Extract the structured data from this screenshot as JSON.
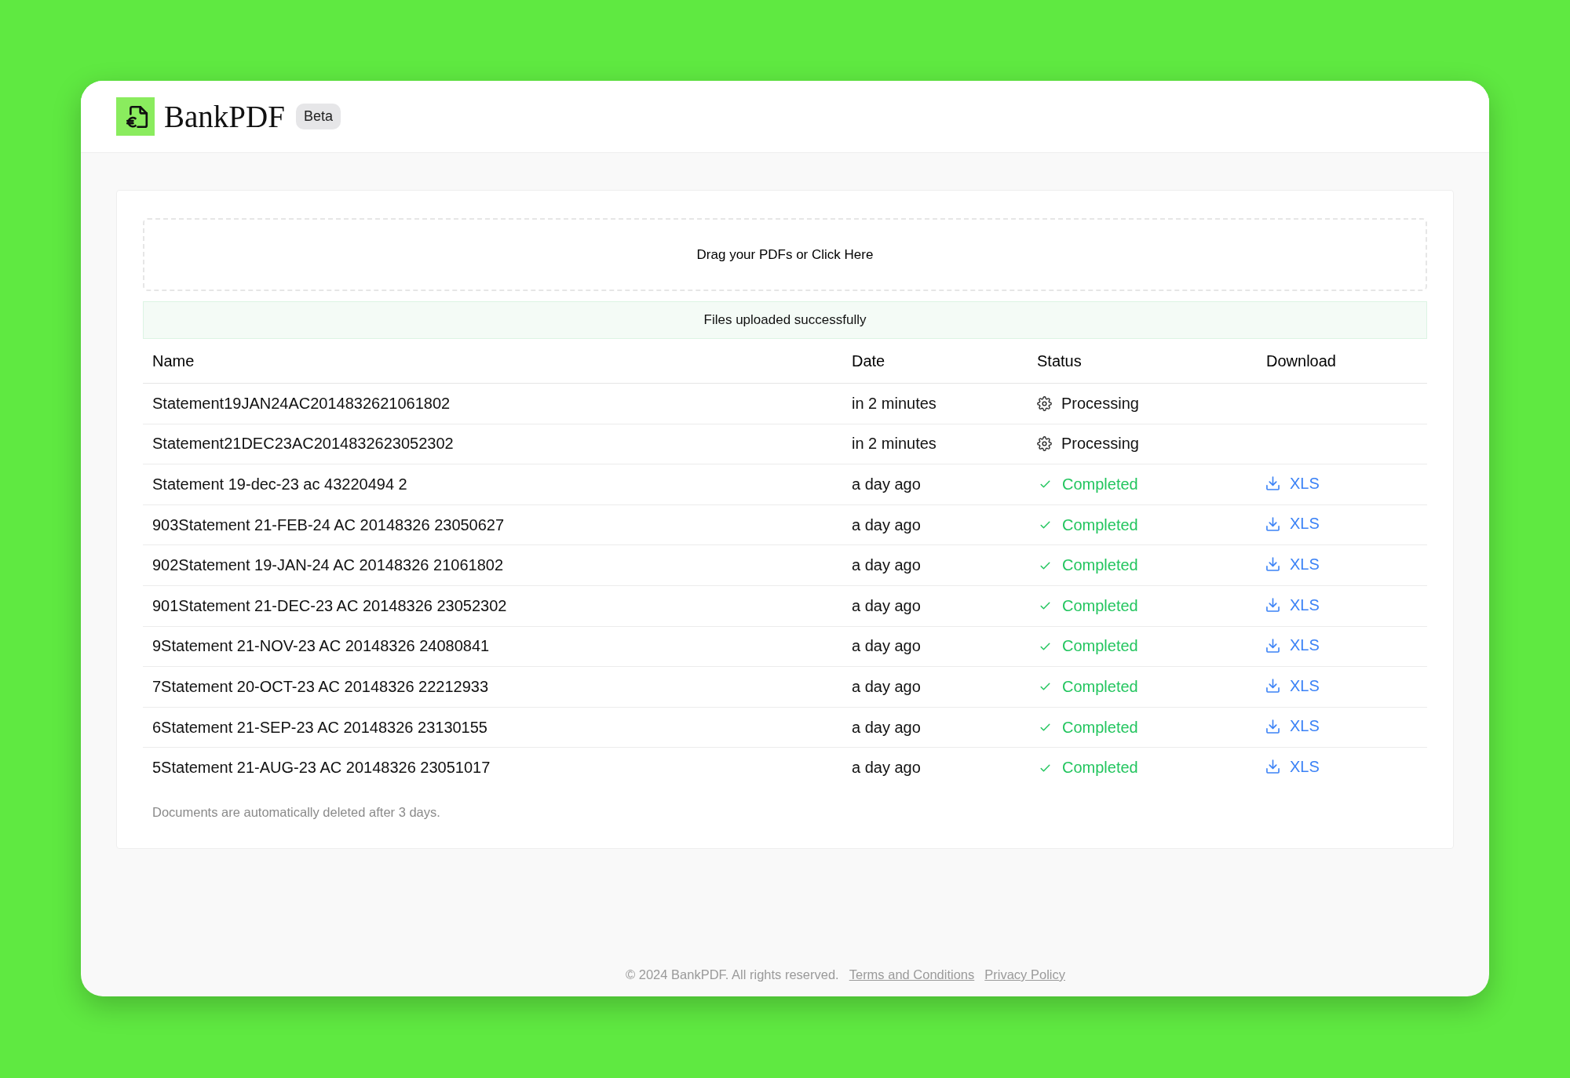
{
  "header": {
    "logo_text": "BankPDF",
    "badge": "Beta"
  },
  "upload": {
    "dropzone_text": "Drag your PDFs or Click Here",
    "message": "Files uploaded successfully"
  },
  "table": {
    "columns": [
      "Name",
      "Date",
      "Status",
      "Download"
    ],
    "rows": [
      {
        "name": "Statement19JAN24AC2014832621061802",
        "date": "in 2 minutes",
        "kind": "processing",
        "status": "Processing"
      },
      {
        "name": "Statement21DEC23AC2014832623052302",
        "date": "in 2 minutes",
        "kind": "processing",
        "status": "Processing"
      },
      {
        "name": "Statement 19-dec-23 ac 43220494 2",
        "date": "a day ago",
        "kind": "completed",
        "status": "Completed",
        "download": "XLS"
      },
      {
        "name": "903Statement 21-FEB-24 AC 20148326 23050627",
        "date": "a day ago",
        "kind": "completed",
        "status": "Completed",
        "download": "XLS"
      },
      {
        "name": "902Statement 19-JAN-24 AC 20148326 21061802",
        "date": "a day ago",
        "kind": "completed",
        "status": "Completed",
        "download": "XLS"
      },
      {
        "name": "901Statement 21-DEC-23 AC 20148326 23052302",
        "date": "a day ago",
        "kind": "completed",
        "status": "Completed",
        "download": "XLS"
      },
      {
        "name": "9Statement 21-NOV-23 AC 20148326 24080841",
        "date": "a day ago",
        "kind": "completed",
        "status": "Completed",
        "download": "XLS"
      },
      {
        "name": "7Statement 20-OCT-23 AC 20148326 22212933",
        "date": "a day ago",
        "kind": "completed",
        "status": "Completed",
        "download": "XLS"
      },
      {
        "name": "6Statement 21-SEP-23 AC 20148326 23130155",
        "date": "a day ago",
        "kind": "completed",
        "status": "Completed",
        "download": "XLS"
      },
      {
        "name": "5Statement 21-AUG-23 AC 20148326 23051017",
        "date": "a day ago",
        "kind": "completed",
        "status": "Completed",
        "download": "XLS"
      }
    ]
  },
  "note": "Documents are automatically deleted after 3 days.",
  "footer": {
    "copyright": "© 2024 BankPDF. All rights reserved.",
    "links": [
      "Terms and Conditions",
      "Privacy Policy"
    ]
  }
}
